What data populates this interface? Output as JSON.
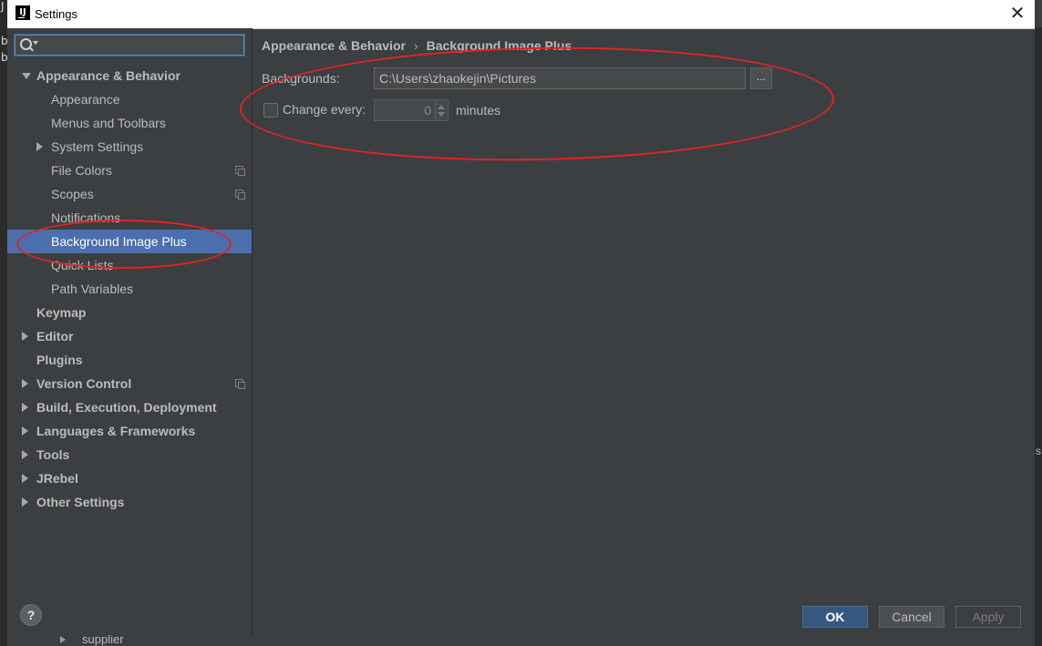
{
  "window": {
    "title": "Settings"
  },
  "sidebar": {
    "search": {
      "value": ""
    },
    "items": [
      {
        "label": "Appearance & Behavior",
        "level": 0,
        "bold": true,
        "arrow": "down"
      },
      {
        "label": "Appearance",
        "level": 1
      },
      {
        "label": "Menus and Toolbars",
        "level": 1
      },
      {
        "label": "System Settings",
        "level": 1,
        "arrow": "right"
      },
      {
        "label": "File Colors",
        "level": 1,
        "copy_icon": true
      },
      {
        "label": "Scopes",
        "level": 1,
        "copy_icon": true
      },
      {
        "label": "Notifications",
        "level": 1
      },
      {
        "label": "Background Image Plus",
        "level": 1,
        "selected": true
      },
      {
        "label": "Quick Lists",
        "level": 1
      },
      {
        "label": "Path Variables",
        "level": 1
      },
      {
        "label": "Keymap",
        "level": 0,
        "bold": true
      },
      {
        "label": "Editor",
        "level": 0,
        "bold": true,
        "arrow": "right"
      },
      {
        "label": "Plugins",
        "level": 0,
        "bold": true
      },
      {
        "label": "Version Control",
        "level": 0,
        "bold": true,
        "arrow": "right",
        "copy_icon": true
      },
      {
        "label": "Build, Execution, Deployment",
        "level": 0,
        "bold": true,
        "arrow": "right"
      },
      {
        "label": "Languages & Frameworks",
        "level": 0,
        "bold": true,
        "arrow": "right"
      },
      {
        "label": "Tools",
        "level": 0,
        "bold": true,
        "arrow": "right"
      },
      {
        "label": "JRebel",
        "level": 0,
        "bold": true,
        "arrow": "right"
      },
      {
        "label": "Other Settings",
        "level": 0,
        "bold": true,
        "arrow": "right"
      }
    ]
  },
  "main": {
    "breadcrumb": [
      "Appearance & Behavior",
      "Background Image Plus"
    ],
    "breadcrumb_separator": "›",
    "backgrounds_label": "Backgrounds:",
    "backgrounds_value": "C:\\Users\\zhaokejin\\Pictures",
    "browse_label": "...",
    "change_every_label": "Change every:",
    "change_every_checked": false,
    "change_every_value": "0",
    "minutes_label": "minutes"
  },
  "footer": {
    "help_label": "?",
    "ok_label": "OK",
    "cancel_label": "Cancel",
    "apply_label": "Apply"
  },
  "background_ide": {
    "left_letters": [
      "J",
      "b",
      "b"
    ],
    "right_letter": "s",
    "tree_item": "supplier"
  },
  "colors": {
    "panel": "#3c3f41",
    "selection": "#4b6eaf",
    "text": "#bbbbbb",
    "accent_button": "#365880",
    "annotation": "#e02424"
  },
  "icons": {
    "app": "intellij-idea-icon",
    "search": "search-icon",
    "close": "close-icon",
    "help": "help-icon"
  }
}
